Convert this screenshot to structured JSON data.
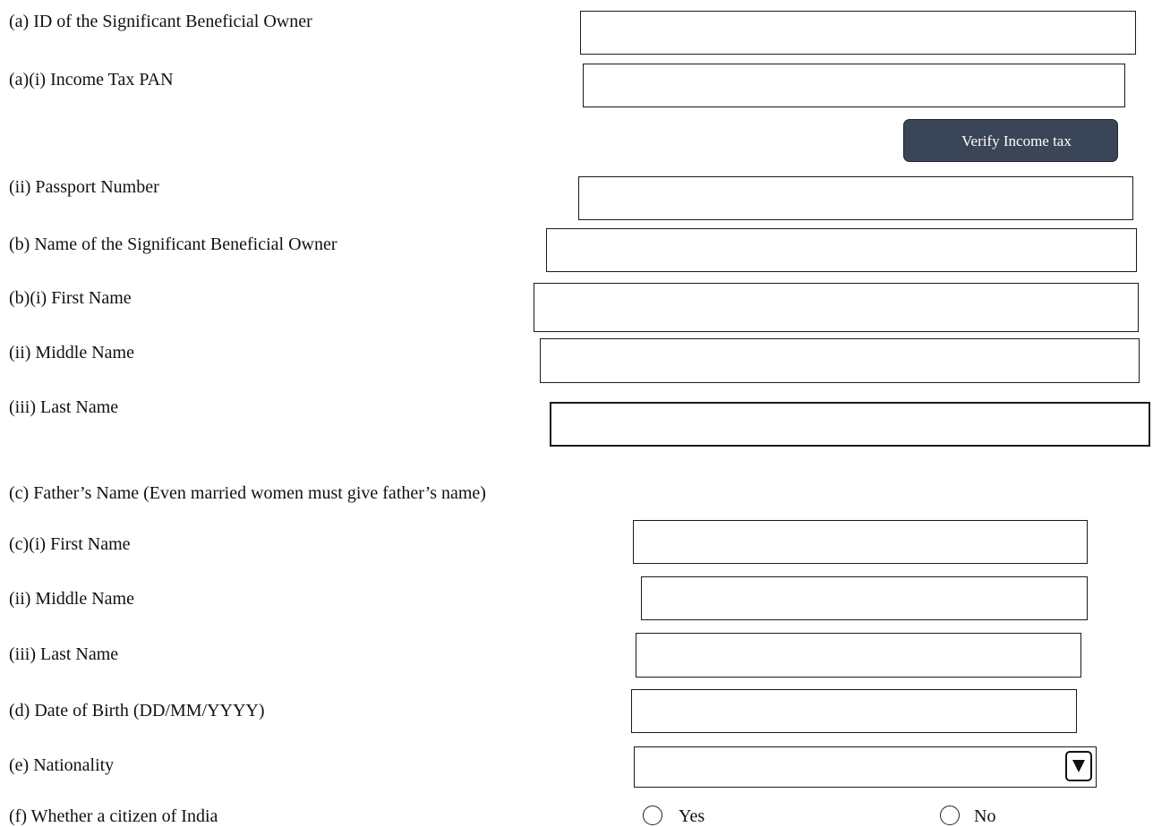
{
  "form": {
    "sbo_id_label": "(a) ID of the Significant Beneficial Owner",
    "pan_label": "(a)(i) Income Tax PAN",
    "verify_button": "Verify Income tax",
    "passport_label": "(ii) Passport Number",
    "sbo_name_label": "(b) Name of the Significant Beneficial Owner",
    "first_name_label": "(b)(i) First Name",
    "middle_name_label": "(ii) Middle Name",
    "last_name_label": "(iii) Last Name",
    "father_section_label": "(c) Father’s Name (Even married women must give father’s name)",
    "father_first_name_label": "(c)(i) First Name",
    "father_middle_name_label": "(ii) Middle Name",
    "father_last_name_label": "(iii) Last Name",
    "dob_label": "(d) Date of Birth (DD/MM/YYYY)",
    "nationality_label": "(e) Nationality",
    "nationality_value": "",
    "citizen_label": "(f) Whether a citizen of India",
    "citizen_options": {
      "yes": "Yes",
      "no": "No"
    }
  },
  "icons": {
    "dropdown": "chevron-down-icon",
    "radio": "radio-unselected-icon"
  }
}
